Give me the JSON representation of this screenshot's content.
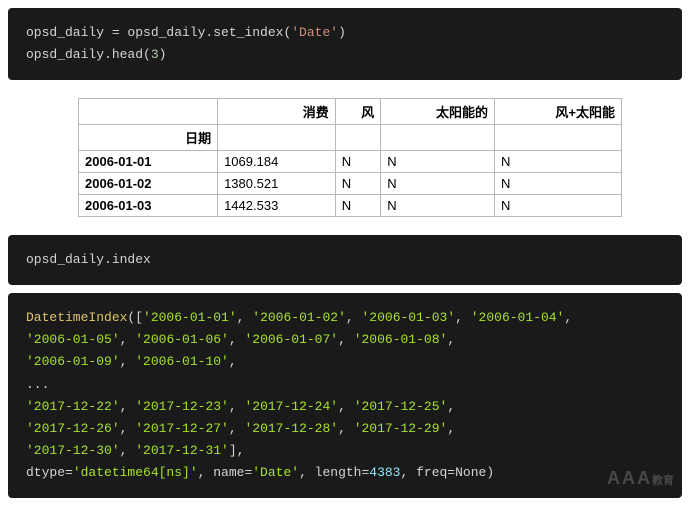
{
  "code1": {
    "var": "opsd_daily",
    "assign": " = opsd_daily.set_index(",
    "arg": "'Date'",
    "close": ")",
    "line2a": "opsd_daily.head(",
    "line2num": "3",
    "line2b": ")"
  },
  "table": {
    "index_label": "日期",
    "columns": [
      "消费",
      "风",
      "太阳能的",
      "风+太阳能"
    ],
    "rows": [
      {
        "index": "2006-01-01",
        "cells": [
          "1069.184",
          "N",
          "N",
          "N"
        ]
      },
      {
        "index": "2006-01-02",
        "cells": [
          "1380.521",
          "N",
          "N",
          "N"
        ]
      },
      {
        "index": "2006-01-03",
        "cells": [
          "1442.533",
          "N",
          "N",
          "N"
        ]
      }
    ]
  },
  "code2": {
    "line": "opsd_daily.index"
  },
  "output": {
    "class": "DatetimeIndex",
    "open": "([",
    "dates1": [
      "'2006-01-01'",
      "'2006-01-02'",
      "'2006-01-03'",
      "'2006-01-04'"
    ],
    "dates2": [
      "'2006-01-05'",
      "'2006-01-06'",
      "'2006-01-07'",
      "'2006-01-08'"
    ],
    "dates3": [
      "'2006-01-09'",
      "'2006-01-10'"
    ],
    "ellipsis": "...",
    "dates4": [
      "'2017-12-22'",
      "'2017-12-23'",
      "'2017-12-24'",
      "'2017-12-25'"
    ],
    "dates5": [
      "'2017-12-26'",
      "'2017-12-27'",
      "'2017-12-28'",
      "'2017-12-29'"
    ],
    "dates6": [
      "'2017-12-30'",
      "'2017-12-31'"
    ],
    "close": "],",
    "dtype_k": "dtype=",
    "dtype_v": "'datetime64[ns]'",
    "name_k": ", name=",
    "name_v": "'Date'",
    "length_k": ", length=",
    "length_v": "4383",
    "freq": ", freq=None)"
  },
  "watermark": {
    "main": "AAA",
    "sub": "教育"
  }
}
